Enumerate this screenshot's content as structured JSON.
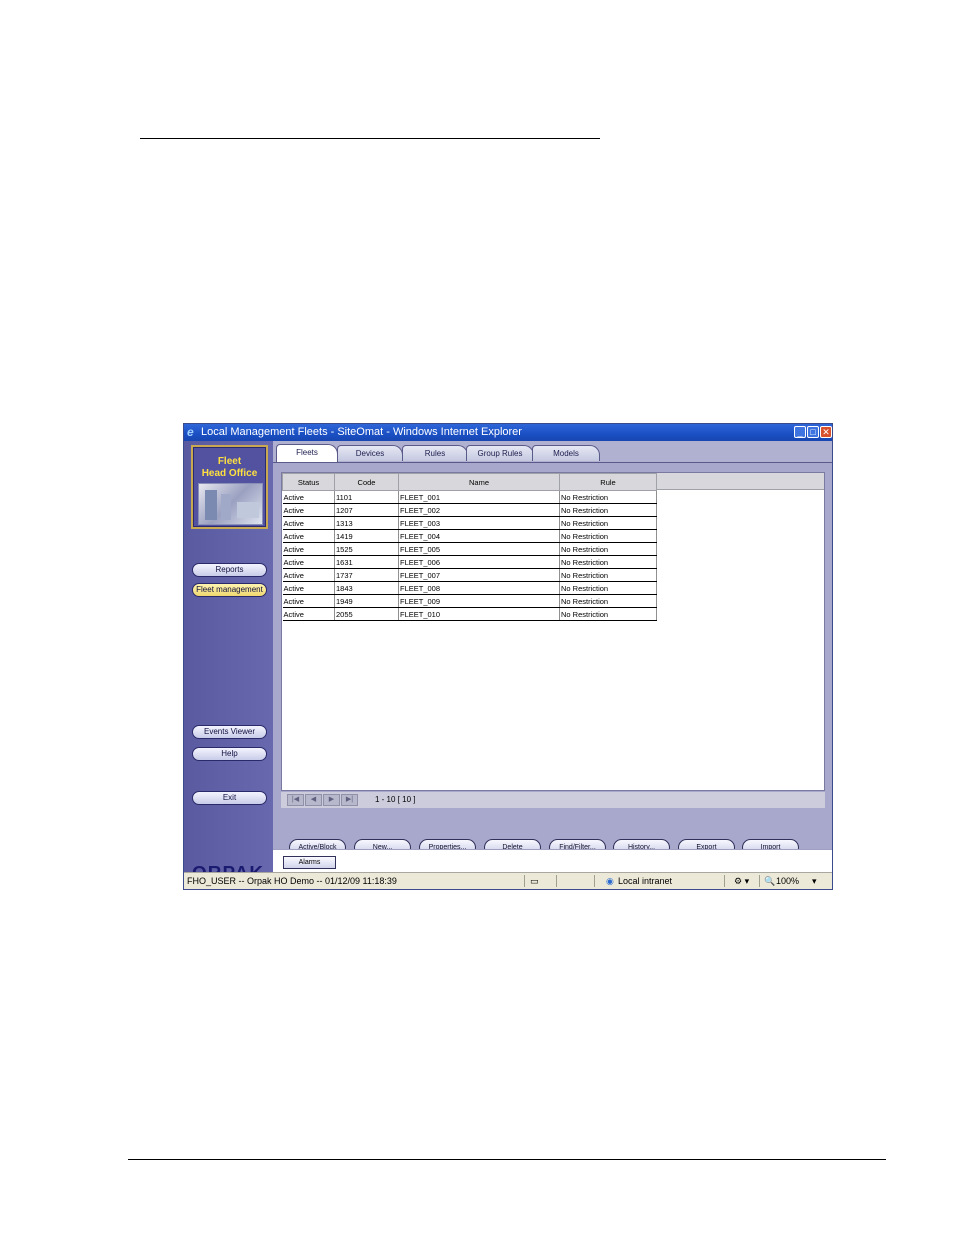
{
  "window": {
    "title": "Local Management Fleets - SiteOmat - Windows Internet Explorer"
  },
  "sidebar": {
    "logo_line1": "Fleet",
    "logo_line2": "Head Office",
    "top_items": [
      {
        "label": "Reports",
        "active": false
      },
      {
        "label": "Fleet management",
        "active": true
      }
    ],
    "bottom_items": [
      {
        "label": "Events Viewer"
      },
      {
        "label": "Help"
      },
      {
        "label": "Exit"
      }
    ],
    "brand": "ORPAK"
  },
  "tabs": [
    {
      "label": "Fleets",
      "active": true
    },
    {
      "label": "Devices",
      "active": false
    },
    {
      "label": "Rules",
      "active": false
    },
    {
      "label": "Group Rules",
      "active": false
    },
    {
      "label": "Models",
      "active": false
    }
  ],
  "table": {
    "columns": [
      "Status",
      "Code",
      "Name",
      "Rule"
    ],
    "rows": [
      [
        "Active",
        "1101",
        "FLEET_001",
        "No Restriction"
      ],
      [
        "Active",
        "1207",
        "FLEET_002",
        "No Restriction"
      ],
      [
        "Active",
        "1313",
        "FLEET_003",
        "No Restriction"
      ],
      [
        "Active",
        "1419",
        "FLEET_004",
        "No Restriction"
      ],
      [
        "Active",
        "1525",
        "FLEET_005",
        "No Restriction"
      ],
      [
        "Active",
        "1631",
        "FLEET_006",
        "No Restriction"
      ],
      [
        "Active",
        "1737",
        "FLEET_007",
        "No Restriction"
      ],
      [
        "Active",
        "1843",
        "FLEET_008",
        "No Restriction"
      ],
      [
        "Active",
        "1949",
        "FLEET_009",
        "No Restriction"
      ],
      [
        "Active",
        "2055",
        "FLEET_010",
        "No Restriction"
      ]
    ]
  },
  "pager": {
    "range_text": "1 - 10  [ 10 ]"
  },
  "actions": [
    "Active/Block",
    "New...",
    "Properties...",
    "Delete",
    "Find/Filter...",
    "History...",
    "Export",
    "Import"
  ],
  "alarm_label": "Alarms",
  "statusbar": {
    "session": "FHO_USER -- Orpak HO Demo -- 01/12/09  11:18:39",
    "zone": "Local intranet",
    "zoom": "100%"
  }
}
